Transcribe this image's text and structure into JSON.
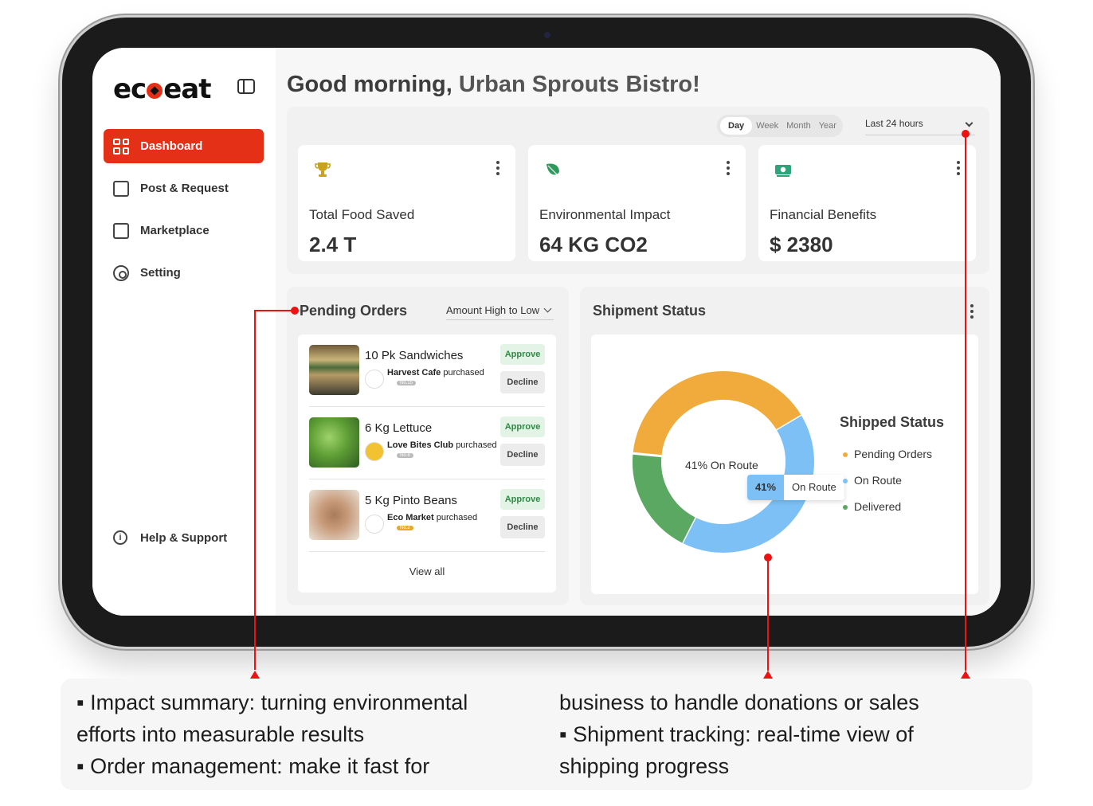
{
  "app": {
    "logo_text_left": "ec",
    "logo_text_right": "eat"
  },
  "sidebar": {
    "items": [
      {
        "label": "Dashboard",
        "icon": "dashboard-grid-icon",
        "active": true
      },
      {
        "label": "Post & Request",
        "icon": "document-icon"
      },
      {
        "label": "Marketplace",
        "icon": "store-icon"
      },
      {
        "label": "Setting",
        "icon": "gear-icon"
      }
    ],
    "help": {
      "label": "Help & Support",
      "icon": "info-icon"
    }
  },
  "header": {
    "greeting": "Good morning,",
    "business": "Urban Sprouts Bistro!"
  },
  "filters": {
    "periods": [
      "Day",
      "Week",
      "Month",
      "Year"
    ],
    "selected_period": "Day",
    "range": "Last 24 hours"
  },
  "stats": [
    {
      "label": "Total Food Saved",
      "value": "2.4 T",
      "icon": "trophy-icon",
      "color": "#c9a21b"
    },
    {
      "label": "Environmental Impact",
      "value": "64 KG CO2",
      "icon": "leaf-icon",
      "color": "#2e9a5b"
    },
    {
      "label": "Financial Benefits",
      "value": "$ 2380",
      "icon": "cash-icon",
      "color": "#2fa37a"
    }
  ],
  "orders": {
    "title": "Pending Orders",
    "sort": "Amount High to Low",
    "approve_label": "Approve",
    "decline_label": "Decline",
    "view_all": "View all",
    "items": [
      {
        "title": "10 Pk Sandwiches",
        "buyer": "Harvest Cafe",
        "verb": "purchased",
        "badge": "No.15"
      },
      {
        "title": "6 Kg Lettuce",
        "buyer": "Love Bites Club",
        "verb": "purchased",
        "badge": "No.8"
      },
      {
        "title": "5 Kg Pinto Beans",
        "buyer": "Eco Market",
        "verb": "purchased",
        "badge": "No.2"
      }
    ]
  },
  "shipment": {
    "title": "Shipment Status",
    "center_label": "41% On Route",
    "tooltip_pct": "41%",
    "tooltip_text": "On Route",
    "legend_title": "Shipped Status",
    "legend": [
      {
        "label": "Pending Orders",
        "color": "#f0ab3c"
      },
      {
        "label": "On Route",
        "color": "#7cc0f5"
      },
      {
        "label": "Delivered",
        "color": "#5aa862"
      }
    ]
  },
  "chart_data": {
    "type": "pie",
    "categories": [
      "Pending Orders",
      "On Route",
      "Delivered"
    ],
    "values": [
      40,
      41,
      19
    ],
    "colors": [
      "#f0ab3c",
      "#7cc0f5",
      "#5aa862"
    ]
  },
  "annotations": {
    "left": [
      "▪ Impact summary: turning environmental",
      "efforts into measurable results",
      "▪ Order management: make it fast for"
    ],
    "right": [
      "business to handle donations or sales",
      "▪ Shipment tracking: real-time view of",
      "shipping progress"
    ]
  }
}
